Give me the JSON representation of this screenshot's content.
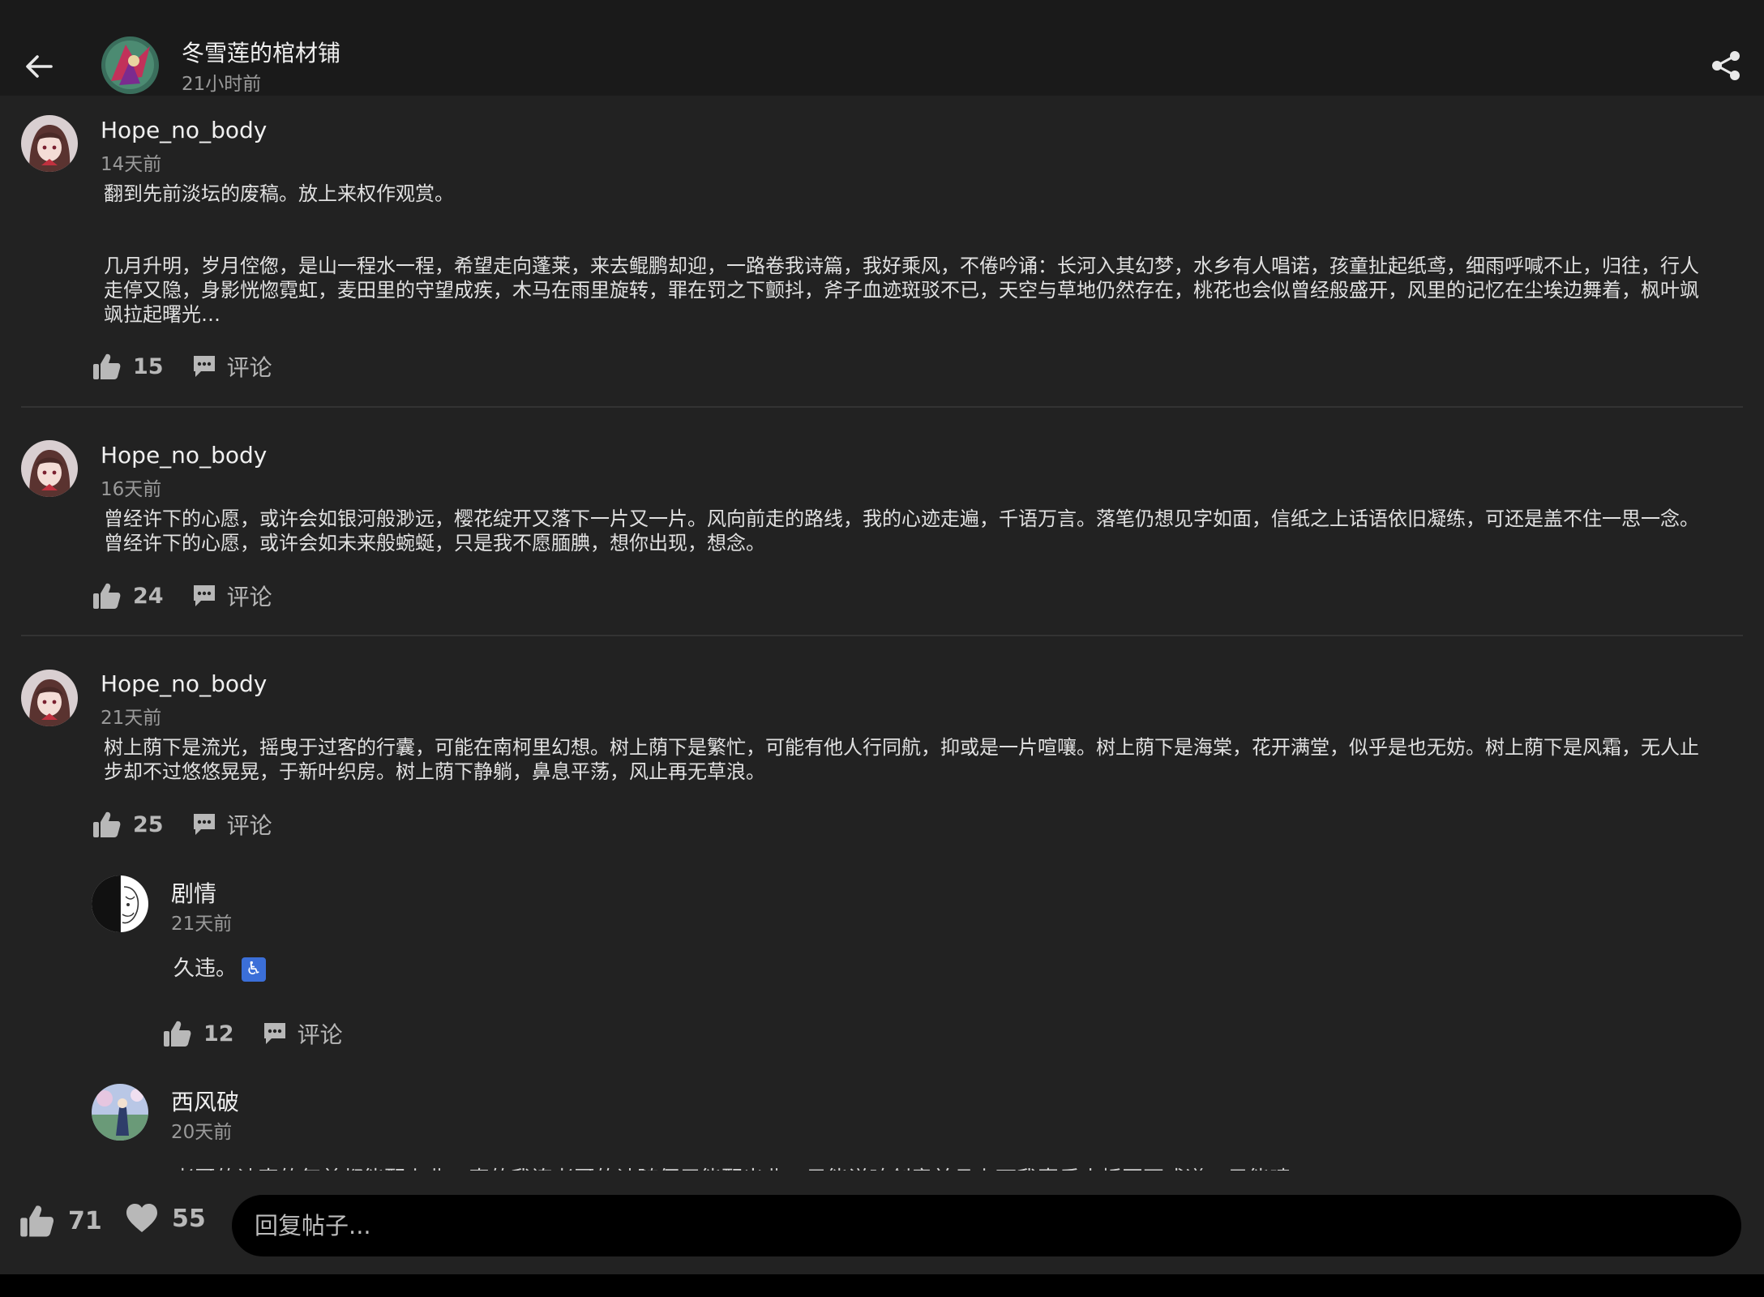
{
  "header": {
    "title": "冬雪莲的棺材铺",
    "time": "21小时前"
  },
  "comments": [
    {
      "username": "Hope_no_body",
      "time": "14天前",
      "text1": "翻到先前淡坛的废稿。放上来权作观赏。",
      "text2": "几月升明，岁月倥偬，是山一程水一程，希望走向蓬莱，来去鲲鹏却迎，一路卷我诗篇，我好乘风，不倦吟诵：长河入其幻梦，水乡有人唱诺，孩童扯起纸鸢，细雨呼喊不止，归往，行人走停又隐，身影恍惚霓虹，麦田里的守望成疾，木马在雨里旋转，罪在罚之下颤抖，斧子血迹斑驳不已，天空与草地仍然存在，桃花也会似曾经般盛开，风里的记忆在尘埃边舞着，枫叶飒飒拉起曙光…",
      "likes": "15",
      "comment_label": "评论"
    },
    {
      "username": "Hope_no_body",
      "time": "16天前",
      "text1": "曾经许下的心愿，或许会如银河般渺远，樱花绽开又落下一片又一片。风向前走的路线，我的心迹走遍，千语万言。落笔仍想见字如面，信纸之上话语依旧凝练，可还是盖不住一思一念。曾经许下的心愿，或许会如未来般蜿蜒，只是我不愿腼腆，想你出现，想念。",
      "likes": "24",
      "comment_label": "评论"
    },
    {
      "username": "Hope_no_body",
      "time": "21天前",
      "text1": "树上荫下是流光，摇曳于过客的行囊，可能在南柯里幻想。树上荫下是繁忙，可能有他人行同航，抑或是一片喧嚷。树上荫下是海棠，花开满堂，似乎是也无妨。树上荫下是风霜，无人止步却不过悠悠晃晃，于新叶织房。树上荫下静躺，鼻息平荡，风止再无草浪。",
      "likes": "25",
      "comment_label": "评论"
    }
  ],
  "replies": [
    {
      "username": "剧情",
      "time": "21天前",
      "text": "久违。",
      "emoji": "♿",
      "likes": "12",
      "comment_label": "评论"
    },
    {
      "username": "西风破",
      "time": "20天前",
      "text": "老哥的诗真的每首都能配上曲，真的我连老哥的诗随便用能配出曲，只能说咱创意并且上下我喜乐小桥写不成道，只能唛"
    }
  ],
  "bottom": {
    "likes": "71",
    "hearts": "55",
    "reply_placeholder": "回复帖子..."
  },
  "colors": {
    "background": "#222222",
    "header": "#1a1a1a",
    "icon": "#b8b8b8"
  }
}
